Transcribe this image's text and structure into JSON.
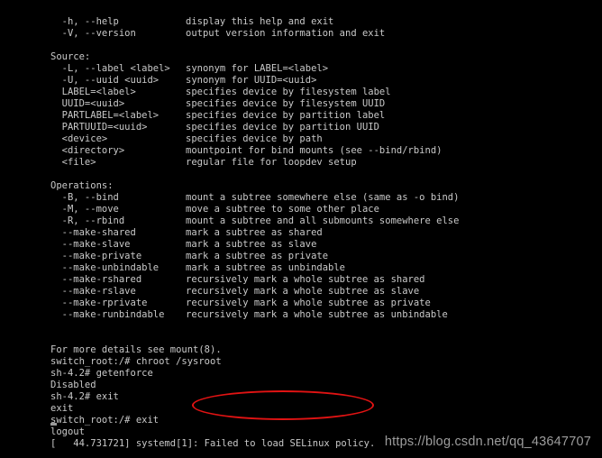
{
  "terminal": {
    "background_color": "#000000",
    "foreground_color": "#c9c9c9",
    "lines": [
      {
        "id": "help-help",
        "opt": "  -h, --help",
        "desc": "display this help and exit"
      },
      {
        "id": "help-version",
        "opt": "  -V, --version",
        "desc": "output version information and exit"
      },
      {
        "id": "blank-1",
        "opt": "",
        "desc": ""
      },
      {
        "id": "heading-source",
        "opt": "Source:",
        "desc": ""
      },
      {
        "id": "src-label",
        "opt": "  -L, --label <label>",
        "desc": "synonym for LABEL=<label>"
      },
      {
        "id": "src-uuid",
        "opt": "  -U, --uuid <uuid>",
        "desc": "synonym for UUID=<uuid>"
      },
      {
        "id": "src-label-eq",
        "opt": "  LABEL=<label>",
        "desc": "specifies device by filesystem label"
      },
      {
        "id": "src-uuid-eq",
        "opt": "  UUID=<uuid>",
        "desc": "specifies device by filesystem UUID"
      },
      {
        "id": "src-partlabel",
        "opt": "  PARTLABEL=<label>",
        "desc": "specifies device by partition label"
      },
      {
        "id": "src-partuuid",
        "opt": "  PARTUUID=<uuid>",
        "desc": "specifies device by partition UUID"
      },
      {
        "id": "src-device",
        "opt": "  <device>",
        "desc": "specifies device by path"
      },
      {
        "id": "src-directory",
        "opt": "  <directory>",
        "desc": "mountpoint for bind mounts (see --bind/rbind)"
      },
      {
        "id": "src-file",
        "opt": "  <file>",
        "desc": "regular file for loopdev setup"
      },
      {
        "id": "blank-2",
        "opt": "",
        "desc": ""
      },
      {
        "id": "heading-operations",
        "opt": "Operations:",
        "desc": ""
      },
      {
        "id": "op-bind",
        "opt": "  -B, --bind",
        "desc": "mount a subtree somewhere else (same as -o bind)"
      },
      {
        "id": "op-move",
        "opt": "  -M, --move",
        "desc": "move a subtree to some other place"
      },
      {
        "id": "op-rbind",
        "opt": "  -R, --rbind",
        "desc": "mount a subtree and all submounts somewhere else"
      },
      {
        "id": "op-make-shared",
        "opt": "  --make-shared",
        "desc": "mark a subtree as shared"
      },
      {
        "id": "op-make-slave",
        "opt": "  --make-slave",
        "desc": "mark a subtree as slave"
      },
      {
        "id": "op-make-private",
        "opt": "  --make-private",
        "desc": "mark a subtree as private"
      },
      {
        "id": "op-make-unbindable",
        "opt": "  --make-unbindable",
        "desc": "mark a subtree as unbindable"
      },
      {
        "id": "op-make-rshared",
        "opt": "  --make-rshared",
        "desc": "recursively mark a whole subtree as shared"
      },
      {
        "id": "op-make-rslave",
        "opt": "  --make-rslave",
        "desc": "recursively mark a whole subtree as slave"
      },
      {
        "id": "op-make-rprivate",
        "opt": "  --make-rprivate",
        "desc": "recursively mark a whole subtree as private"
      },
      {
        "id": "op-make-runbindable",
        "opt": "  --make-runbindable",
        "desc": "recursively mark a whole subtree as unbindable"
      },
      {
        "id": "blank-3",
        "opt": "",
        "desc": ""
      },
      {
        "id": "blank-4",
        "opt": "",
        "desc": ""
      },
      {
        "id": "footer-manpage",
        "opt": "For more details see mount(8).",
        "desc": ""
      },
      {
        "id": "cmd-chroot",
        "opt": "switch_root:/# chroot /sysroot",
        "desc": ""
      },
      {
        "id": "cmd-getenforce",
        "opt": "sh-4.2# getenforce",
        "desc": ""
      },
      {
        "id": "out-disabled",
        "opt": "Disabled",
        "desc": ""
      },
      {
        "id": "cmd-exit-1",
        "opt": "sh-4.2# exit",
        "desc": ""
      },
      {
        "id": "out-exit",
        "opt": "exit",
        "desc": ""
      },
      {
        "id": "cmd-exit-2",
        "opt": "switch_root:/# exit",
        "desc": ""
      },
      {
        "id": "out-logout",
        "opt": "logout",
        "desc": ""
      },
      {
        "id": "kernel-selinux",
        "opt": "[   44.731721] systemd[1]: Failed to load SELinux policy.",
        "desc": ""
      }
    ]
  },
  "annotation": {
    "shape": "ellipse",
    "color": "#e11313",
    "highlights_text": "Failed to load SELinux policy."
  },
  "cursor": {
    "visible": true,
    "style": "underscore-block"
  },
  "watermark": {
    "text": "https://blog.csdn.net/qq_43647707",
    "color": "#9d9d9d"
  }
}
